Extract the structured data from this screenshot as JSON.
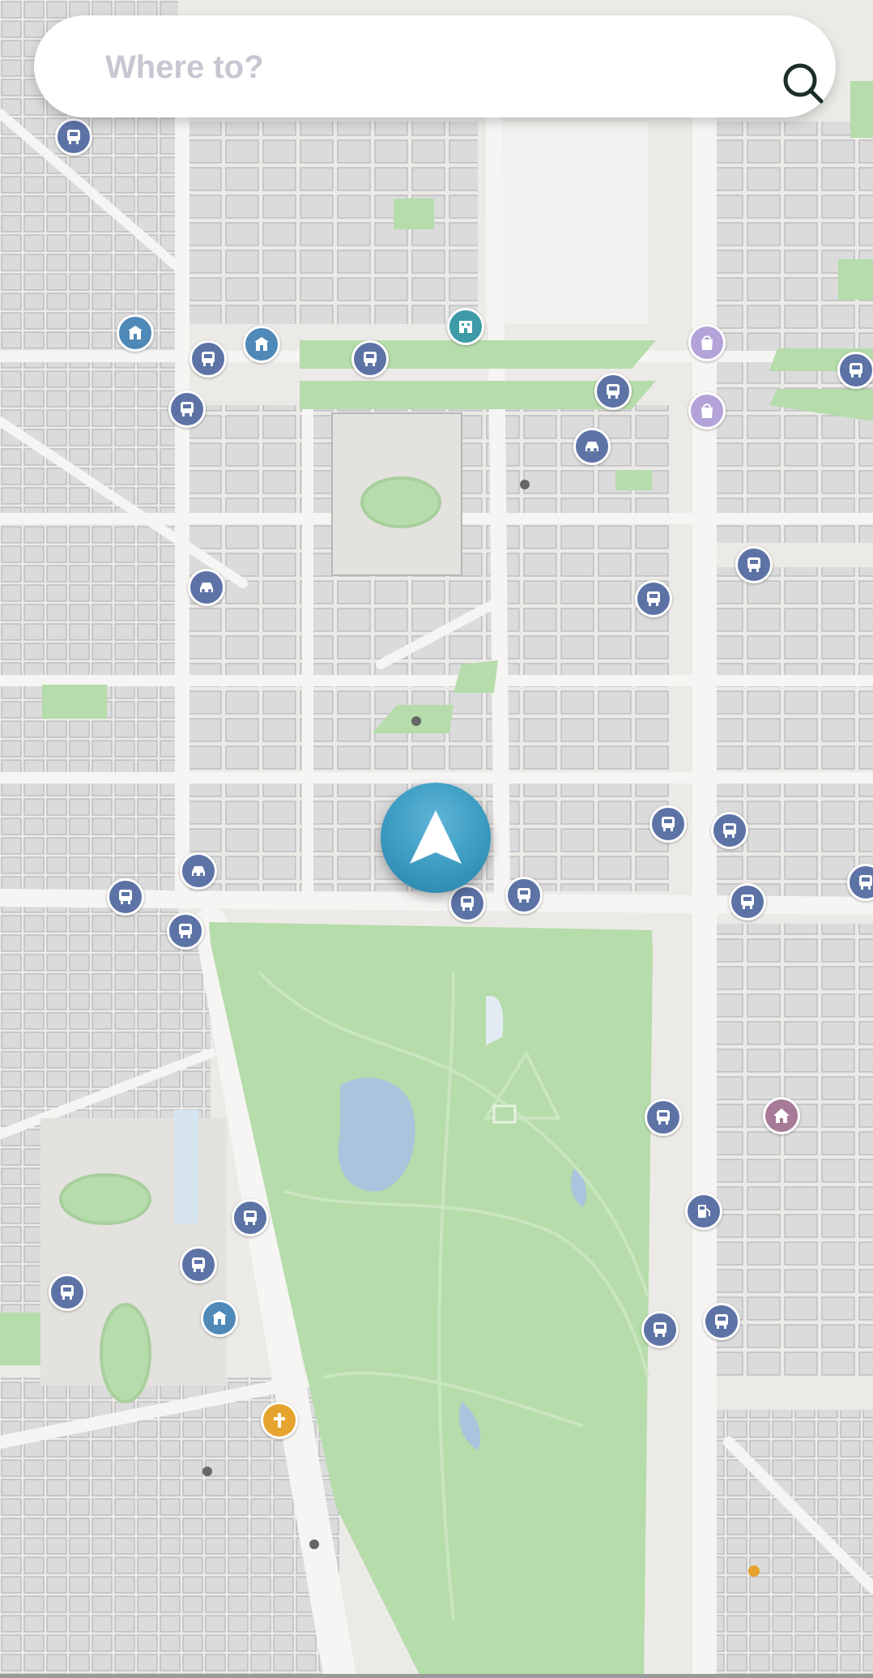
{
  "search": {
    "placeholder": "Where to?",
    "icon": "search-icon"
  },
  "map": {
    "colors": {
      "background": "#eceae6",
      "park": "#b5dcaa",
      "building": "#d9d9db",
      "road": "#f6f5f3",
      "water": "#a9c4dc",
      "location_marker": "#3a9ac0",
      "bus_stop": "#5d73a6",
      "church": "#e6a42f"
    },
    "location_marker": "navigation-arrow-icon",
    "poi_types": [
      "bus-stop-icon",
      "car-icon",
      "school-icon",
      "shopping-bag-icon",
      "home-icon",
      "church-icon",
      "fuel-icon"
    ]
  }
}
